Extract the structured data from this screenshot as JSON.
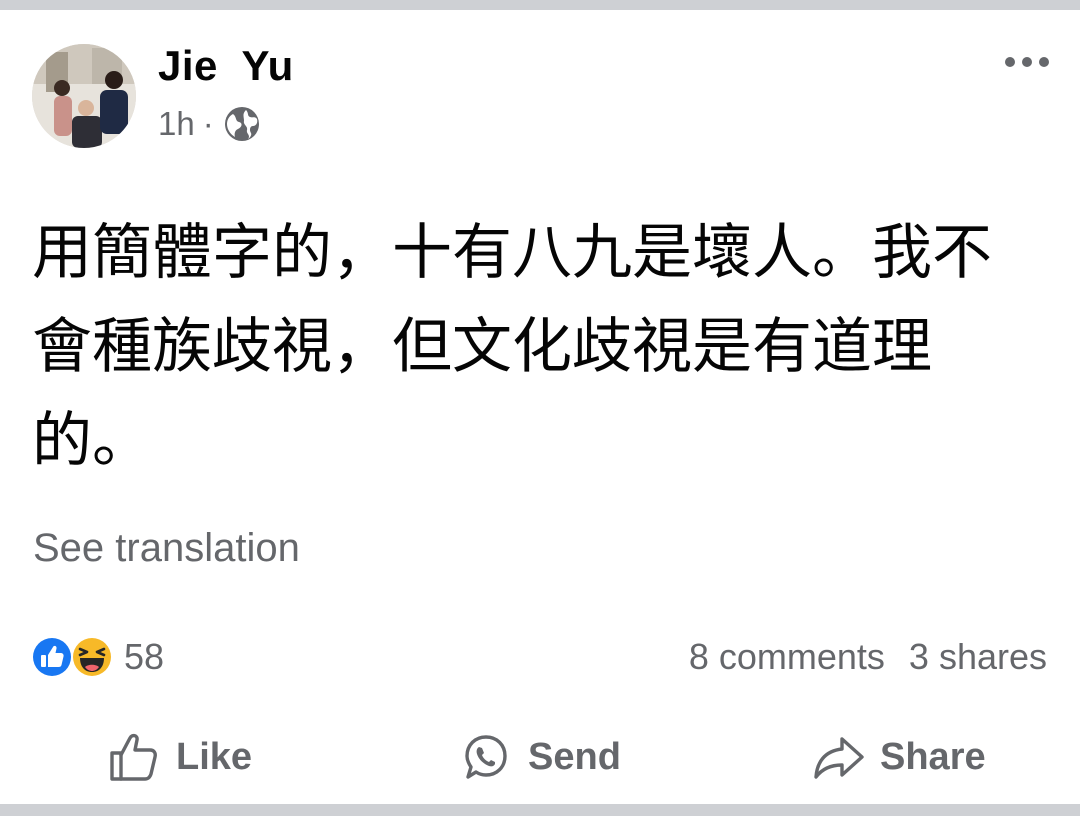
{
  "post": {
    "author": "Jie  Yu",
    "time": "1h",
    "separator": "·",
    "privacy_icon": "globe-icon",
    "text": "用簡體字的，十有八九是壞人。我不會種族歧視，但文化歧視是有道理的。",
    "see_translation": "See translation"
  },
  "reactions": {
    "icons": [
      "like-reaction-icon",
      "haha-reaction-icon"
    ],
    "count": "58",
    "comments": "8 comments",
    "shares": "3 shares"
  },
  "actions": {
    "like_label": "Like",
    "send_label": "Send",
    "share_label": "Share"
  },
  "colors": {
    "text_primary": "#050505",
    "text_secondary": "#65676b",
    "like_blue": "#1877f2",
    "haha_yellow": "#f7b928",
    "divider": "#ced0d4"
  }
}
